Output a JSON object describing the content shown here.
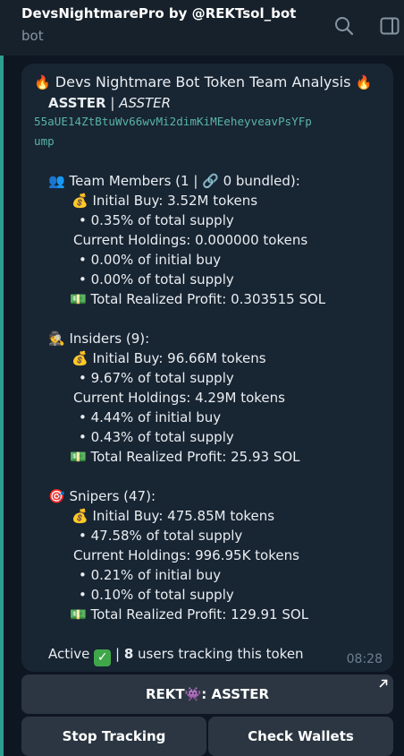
{
  "header": {
    "title": "DevsNightmarePro by @REKTsol_bot",
    "status": "bot"
  },
  "message": {
    "title_prefix": "🔥",
    "title": "Devs Nightmare Bot Token Team Analysis",
    "title_suffix": "🔥",
    "token_name": "ASSTER",
    "token_separator": "|",
    "token_symbol": "ASSTER",
    "address_line1": "55aUE14ZtBtuWv66wvMi2dimKiMEeheyveavPsYFp",
    "address_line2": "ump",
    "sections": [
      {
        "icon": "👥",
        "heading": "Team Members (1 | 🔗 0 bundled):",
        "initial_buy": "Initial Buy: 3.52M tokens",
        "initial_buy_pct": "• 0.35% of total supply",
        "current_holdings": "Current Holdings: 0.000000 tokens",
        "holdings_initial_pct": "• 0.00% of initial buy",
        "holdings_supply_pct": "• 0.00% of total supply",
        "profit": "Total Realized Profit: 0.303515 SOL"
      },
      {
        "icon": "🕵",
        "heading": "Insiders (9):",
        "initial_buy": "Initial Buy: 96.66M tokens",
        "initial_buy_pct": "• 9.67% of total supply",
        "current_holdings": "Current Holdings: 4.29M tokens",
        "holdings_initial_pct": "• 4.44% of initial buy",
        "holdings_supply_pct": "• 0.43% of total supply",
        "profit": "Total Realized Profit: 25.93 SOL"
      },
      {
        "icon": "🎯",
        "heading": "Snipers (47):",
        "initial_buy": "Initial Buy: 475.85M tokens",
        "initial_buy_pct": "• 47.58% of total supply",
        "current_holdings": "Current Holdings: 996.95K tokens",
        "holdings_initial_pct": "• 0.21% of initial buy",
        "holdings_supply_pct": "• 0.10% of total supply",
        "profit": "Total Realized Profit: 129.91 SOL"
      }
    ],
    "money_bag": "💰",
    "money_bill": "💵",
    "active_label": "Active",
    "active_check": "✓",
    "tracking_separator": "|",
    "tracking_count": "8",
    "tracking_text": "users tracking this token",
    "time": "08:28"
  },
  "keyboard": {
    "link_button": "REKT👾: ASSTER",
    "stop_tracking": "Stop Tracking",
    "check_wallets": "Check Wallets"
  },
  "colors": {
    "header_bg": "#17212b",
    "chat_bg": "#0e1621",
    "bubble_bg": "#182533",
    "accent": "#2e9e8f",
    "address": "#59b4a8",
    "button_bg": "#2b3642",
    "check_green": "#3fa74a"
  }
}
